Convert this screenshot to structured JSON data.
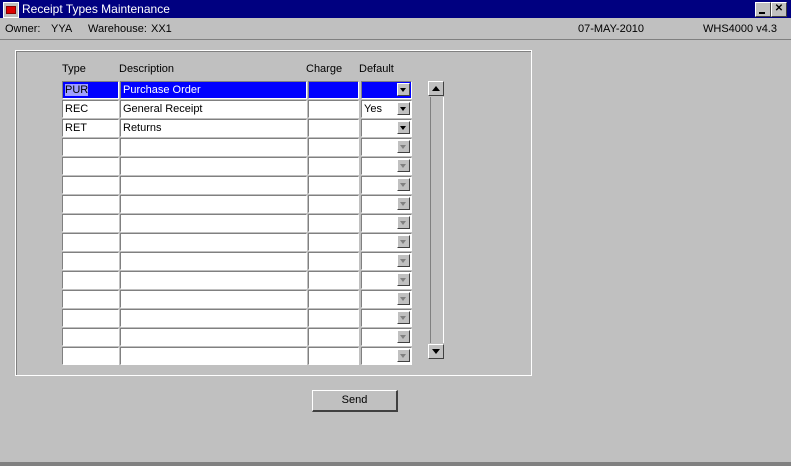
{
  "window": {
    "title": "Receipt Types Maintenance",
    "min_glyph": "",
    "close_glyph": "✕"
  },
  "status": {
    "owner_label": "Owner:",
    "owner_value": "YYA",
    "warehouse_label": "Warehouse:",
    "warehouse_value": "XX1",
    "date": "07-MAY-2010",
    "program": "WHS4000  v4.3"
  },
  "columns": {
    "type": "Type",
    "description": "Description",
    "charge": "Charge",
    "default": "Default"
  },
  "rows": [
    {
      "type": "PUR",
      "description": "Purchase Order",
      "charge": "",
      "default": ""
    },
    {
      "type": "REC",
      "description": "General Receipt",
      "charge": "",
      "default": "Yes"
    },
    {
      "type": "RET",
      "description": "Returns",
      "charge": "",
      "default": ""
    },
    {
      "type": "",
      "description": "",
      "charge": "",
      "default": ""
    },
    {
      "type": "",
      "description": "",
      "charge": "",
      "default": ""
    },
    {
      "type": "",
      "description": "",
      "charge": "",
      "default": ""
    },
    {
      "type": "",
      "description": "",
      "charge": "",
      "default": ""
    },
    {
      "type": "",
      "description": "",
      "charge": "",
      "default": ""
    },
    {
      "type": "",
      "description": "",
      "charge": "",
      "default": ""
    },
    {
      "type": "",
      "description": "",
      "charge": "",
      "default": ""
    },
    {
      "type": "",
      "description": "",
      "charge": "",
      "default": ""
    },
    {
      "type": "",
      "description": "",
      "charge": "",
      "default": ""
    },
    {
      "type": "",
      "description": "",
      "charge": "",
      "default": ""
    },
    {
      "type": "",
      "description": "",
      "charge": "",
      "default": ""
    },
    {
      "type": "",
      "description": "",
      "charge": "",
      "default": ""
    }
  ],
  "buttons": {
    "send": "Send"
  },
  "colors": {
    "title_bar": "#000080",
    "selection": "#0000ff",
    "face": "#c0c0c0"
  }
}
